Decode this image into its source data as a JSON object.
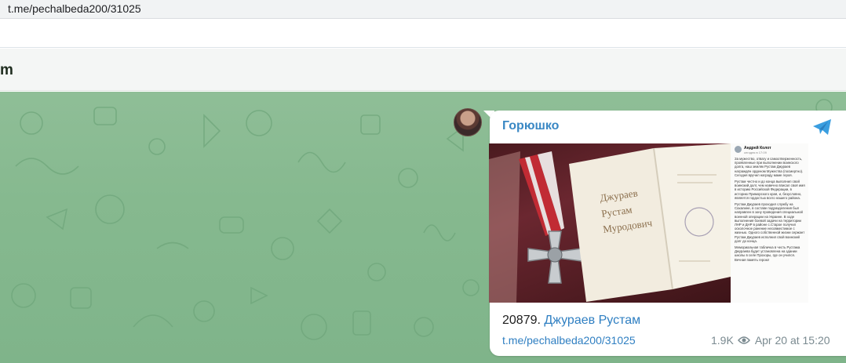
{
  "browser": {
    "url": "t.me/pechalbeda200/31025"
  },
  "chat": {
    "title": "m"
  },
  "post": {
    "channel": "Горюшко",
    "caption_number": "20879.",
    "caption_name": "Джураев Рустам",
    "link": "t.me/pechalbeda200/31025",
    "views": "1.9K",
    "date": "Apr 20 at 15:20",
    "document": {
      "author": "Андрей Колот",
      "date": "сегодня в 17:09",
      "paragraphs": [
        "За мужество, отвагу и самоотверженность, проявленные при выполнении воинского долга, наш земляк Рустам Джураев награждён орденом Мужества (посмертно). Сегодня вручил награду маме героя.",
        "Рустам честно и до конца выполнил свой воинский долг, чем навечно вписал своё имя в историю Российской Федерации, в историю Приморского края, и, безусловно, является гордостью всего нашего района.",
        "Рустам Джураев проходил службу на Сахалине, в составе подразделения был направлен в зону проведения специальной военной операции на Украине. В ходе выполнения боевой задачи на территории ЛНР и ДНР в районе с.Старое получил осколочное ранение несовместимое с жизнью. Одного собственной жизни сержант Рустам Джураев исполнил свой воинский долг до конца.",
        "Мемориальная табличка в честь Рустама Джураева будет установлена на здании школы в селе Прохоры, где он учился. Вечная память герою!"
      ]
    },
    "photo": {
      "book_line1": "Джураев",
      "book_line2": "Рустам",
      "book_line3": "Муродович"
    }
  },
  "icons": {
    "telegram": "telegram-logo-icon",
    "views": "eye-icon",
    "avatar": "channel-avatar"
  },
  "colors": {
    "accent": "#3a88c4",
    "chat_bg": "#86b98f",
    "link": "#2f7fc2"
  }
}
